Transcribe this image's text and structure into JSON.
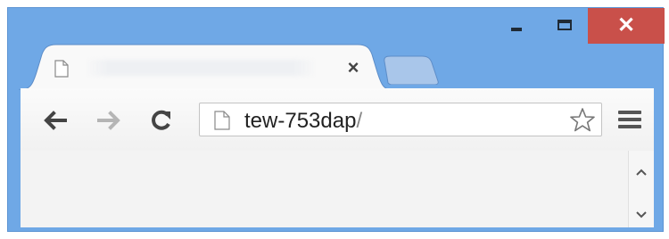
{
  "window": {
    "controls": {
      "minimize_icon": "minimize-icon",
      "maximize_icon": "maximize-icon",
      "close_label": "✕",
      "close_color": "#c9504a"
    }
  },
  "tabs": {
    "active": {
      "title": "",
      "close_label": "×",
      "icon": "page-icon"
    },
    "new_tab_icon": "new-tab-icon"
  },
  "toolbar": {
    "back_icon": "back-arrow-icon",
    "forward_icon": "forward-arrow-icon",
    "reload_icon": "reload-icon",
    "menu_icon": "hamburger-menu-icon"
  },
  "omnibox": {
    "url_host": "tew-753dap",
    "url_path": "/",
    "bookmark_icon": "star-icon"
  },
  "colors": {
    "frame": "#6fa8e6",
    "toolbar": "#f1f1f1",
    "close_button": "#c9504a"
  }
}
